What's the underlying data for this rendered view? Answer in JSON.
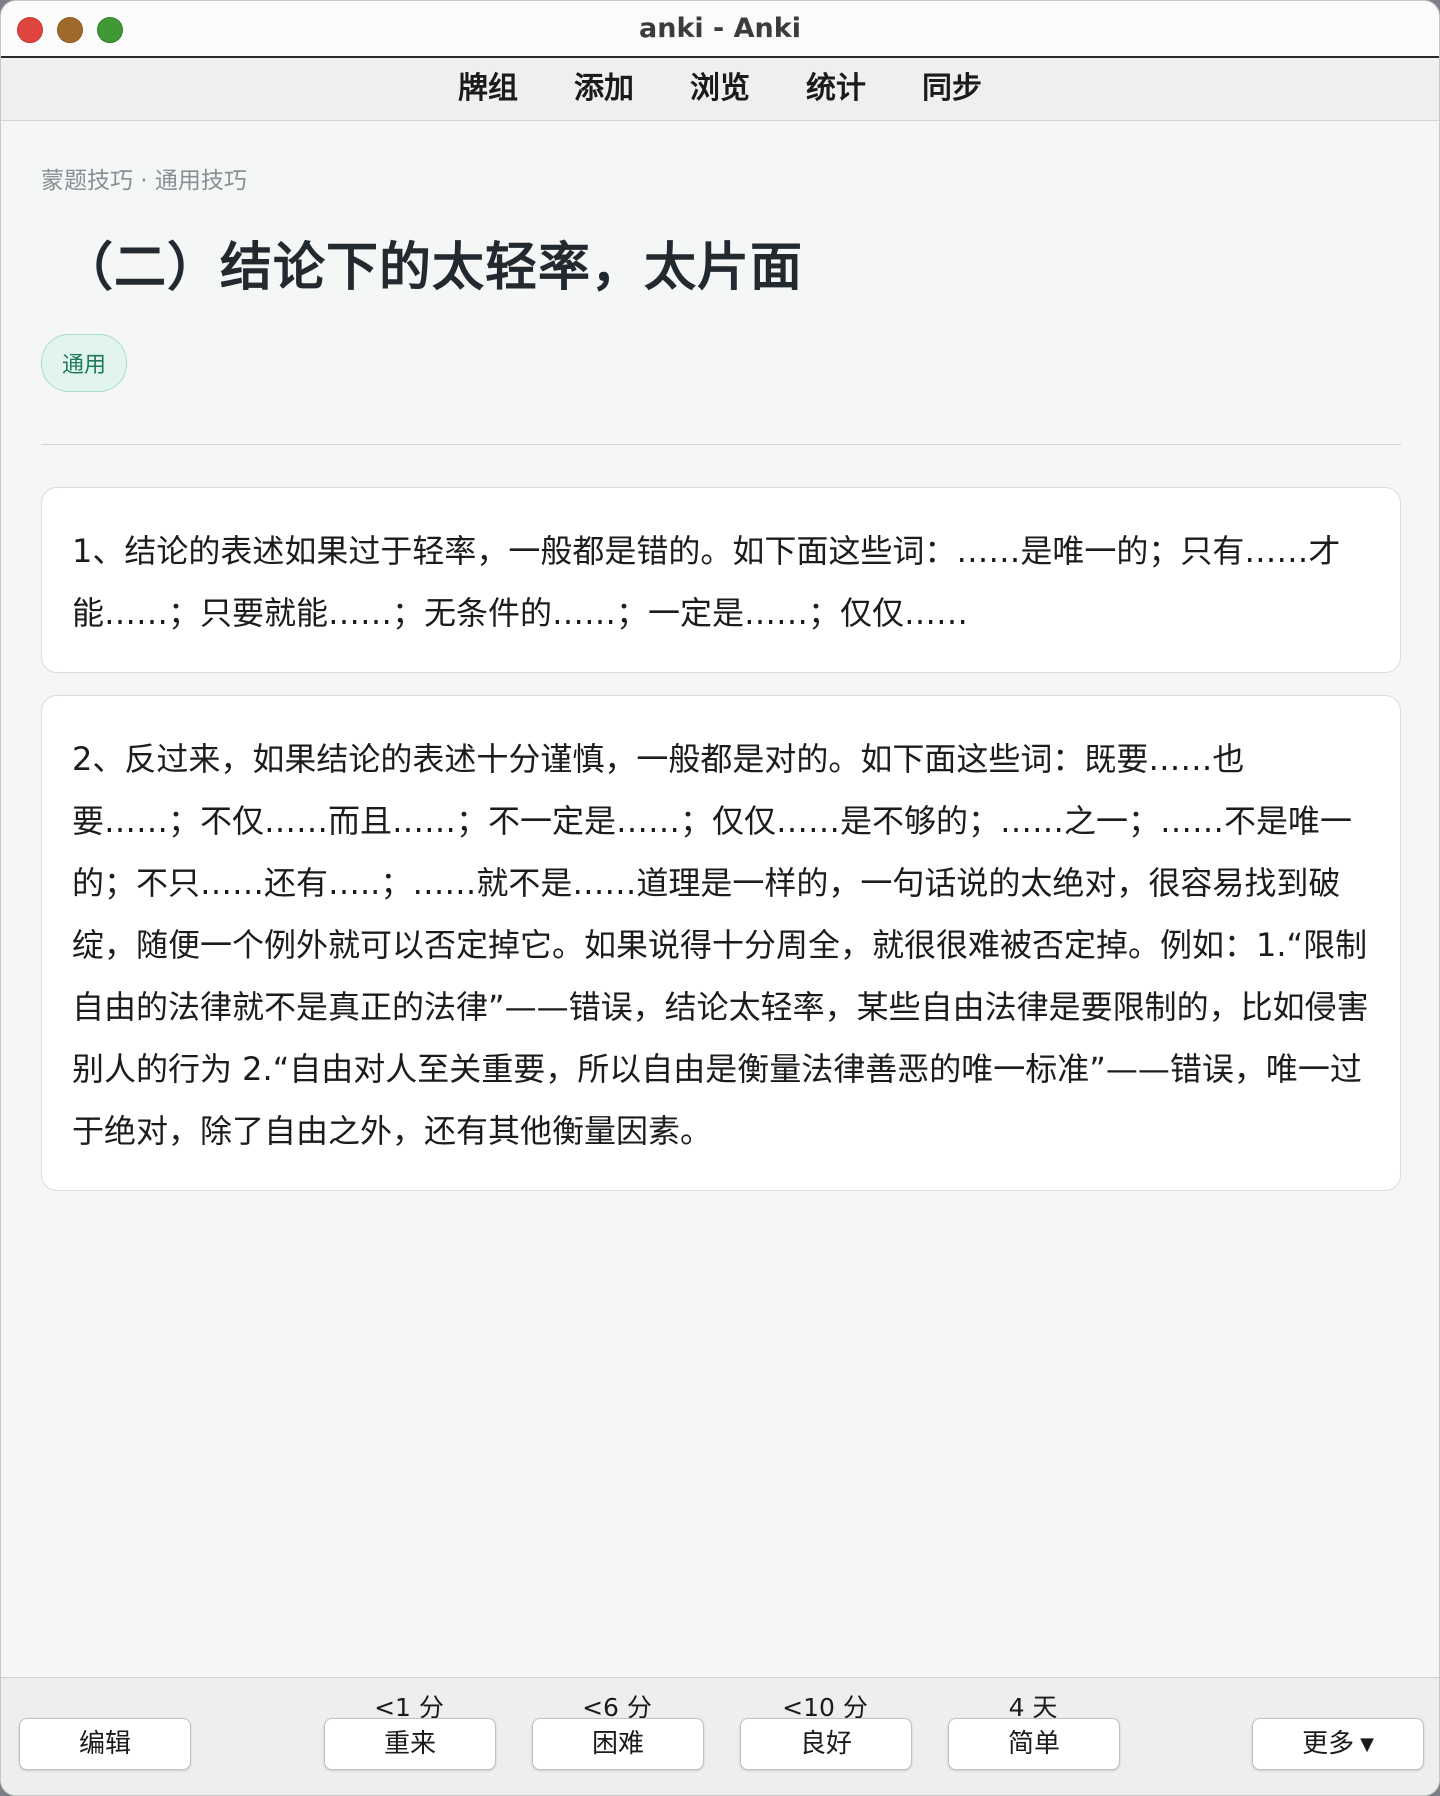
{
  "window": {
    "title": "anki - Anki"
  },
  "toplinks": [
    "牌组",
    "添加",
    "浏览",
    "统计",
    "同步"
  ],
  "card": {
    "breadcrumb": "蒙题技巧 · 通用技巧",
    "title": "（二）结论下的太轻率，太片面",
    "tag": "通用",
    "paragraphs": [
      "1、结论的表述如果过于轻率，一般都是错的。如下面这些词：……是唯一的；只有……才能……；只要就能……；无条件的……；一定是……；仅仅……",
      "2、反过来，如果结论的表述十分谨慎，一般都是对的。如下面这些词：既要……也要……；不仅……而且……；不一定是……；仅仅……是不够的；……之一；……不是唯一的；不只……还有…..；……就不是……道理是一样的，一句话说的太绝对，很容易找到破绽，随便一个例外就可以否定掉它。如果说得十分周全，就很很难被否定掉。例如：1.“限制自由的法律就不是真正的法律”——错误，结论太轻率，某些自由法律是要限制的，比如侵害别人的行为 2.“自由对人至关重要，所以自由是衡量法律善恶的唯一标准”——错误，唯一过于绝对，除了自由之外，还有其他衡量因素。"
    ]
  },
  "answer_bar": {
    "edit_label": "编辑",
    "more_label": "更多",
    "buttons": [
      {
        "interval": "<1 分",
        "label": "重来"
      },
      {
        "interval": "<6 分",
        "label": "困难"
      },
      {
        "interval": "<10 分",
        "label": "良好"
      },
      {
        "interval": "4 天",
        "label": "简单"
      }
    ]
  }
}
